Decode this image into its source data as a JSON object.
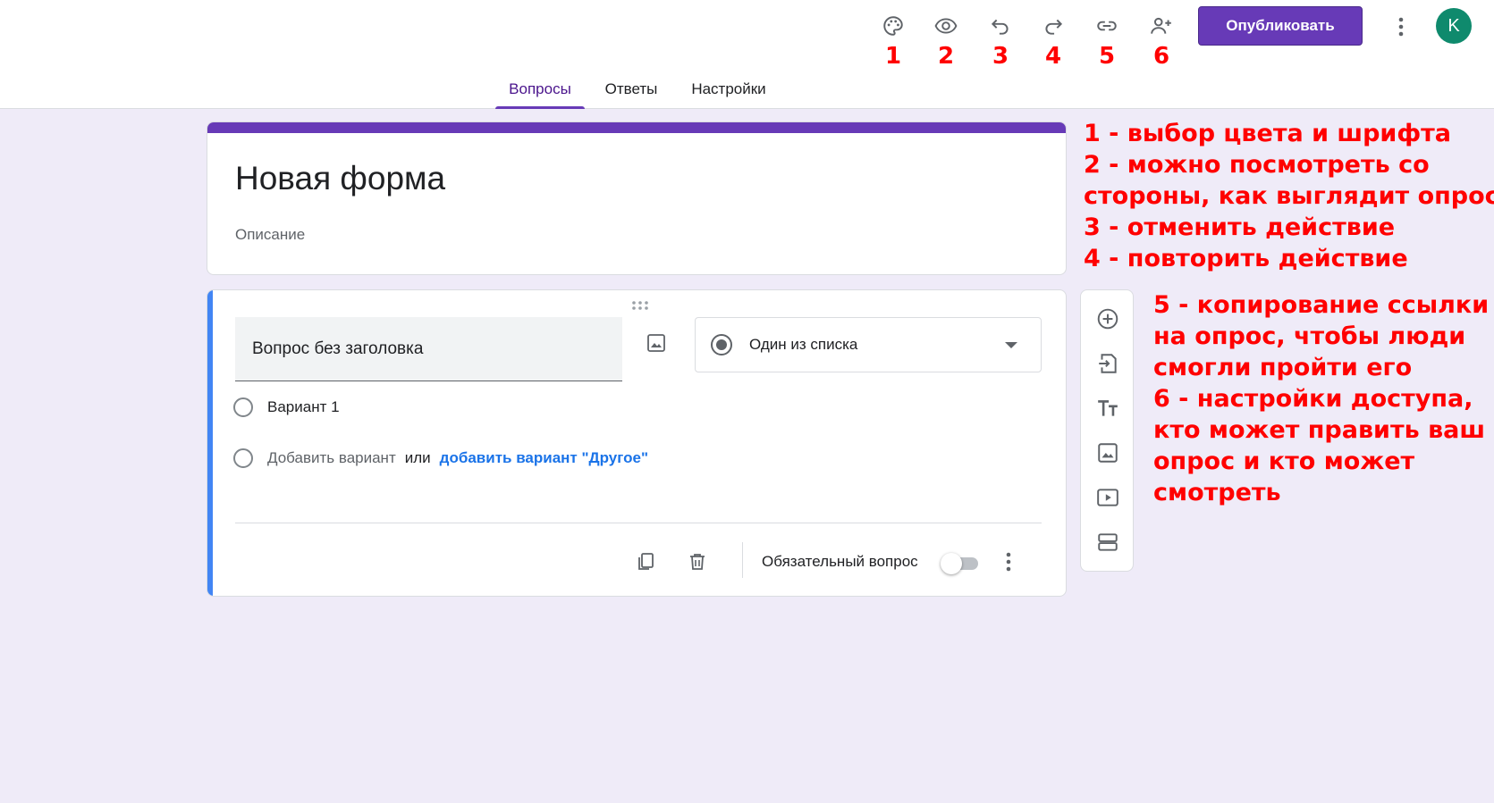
{
  "header": {
    "icons": [
      {
        "name": "palette-icon",
        "number": "1"
      },
      {
        "name": "eye-icon",
        "number": "2"
      },
      {
        "name": "undo-icon",
        "number": "3"
      },
      {
        "name": "redo-icon",
        "number": "4"
      },
      {
        "name": "link-icon",
        "number": "5"
      },
      {
        "name": "add-person-icon",
        "number": "6"
      }
    ],
    "publish_label": "Опубликовать",
    "avatar_letter": "K",
    "accent_color": "#673ab7"
  },
  "tabs": [
    {
      "label": "Вопросы",
      "active": true
    },
    {
      "label": "Ответы",
      "active": false
    },
    {
      "label": "Настройки",
      "active": false
    }
  ],
  "form": {
    "title": "Новая форма",
    "description_placeholder": "Описание"
  },
  "question": {
    "title_placeholder": "Вопрос без заголовка",
    "type_label": "Один из списка",
    "option_1": "Вариант 1",
    "add_option": "Добавить вариант",
    "or_word": "или",
    "add_other": "добавить вариант \"Другое\"",
    "required_label": "Обязательный вопрос",
    "required_on": false
  },
  "sidebar": {
    "icons": [
      "add-question-icon",
      "import-questions-icon",
      "add-title-icon",
      "add-image-icon",
      "add-video-icon",
      "add-section-icon"
    ]
  },
  "annotations": {
    "lines_top": [
      "1 - выбор цвета и шрифта",
      "2 - можно посмотреть со",
      "стороны, как выглядит опрос",
      "3 - отменить действие",
      "4 - повторить действие"
    ],
    "lines_bottom": [
      "5 - копирование ссылки",
      "на опрос, чтобы люди",
      "смогли пройти его",
      "6 - настройки доступа,",
      "кто может править ваш",
      "опрос и кто может",
      "смотреть"
    ]
  }
}
